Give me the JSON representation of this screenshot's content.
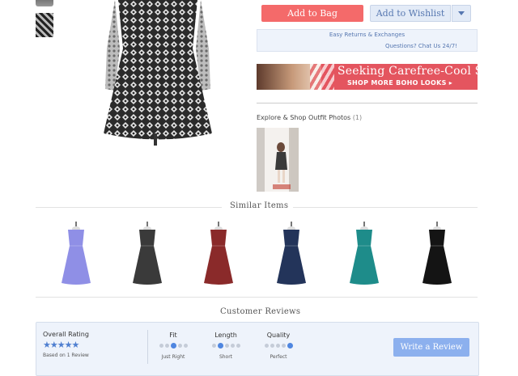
{
  "product": {
    "add_to_bag": "Add to Bag",
    "add_to_wishlist": "Add to Wishlist"
  },
  "info": {
    "returns": "Easy Returns & Exchanges",
    "chat": "Questions? Chat Us 24/7!"
  },
  "banner": {
    "title": "Seeking Carefree-Cool Style?",
    "cta": "SHOP MORE BOHO LOOKS ▸"
  },
  "outfit": {
    "label": "Explore & Shop Outfit Photos",
    "count": "(1)"
  },
  "similar": {
    "title": "Similar Items",
    "items": [
      {
        "icon": "dress-icon",
        "color": "#8f8fe6"
      },
      {
        "icon": "dress-icon",
        "color": "#3a3a3a"
      },
      {
        "icon": "dress-icon",
        "color": "#8a2a2a"
      },
      {
        "icon": "dress-icon",
        "color": "#23345a"
      },
      {
        "icon": "dress-icon",
        "color": "#1e8c8a"
      },
      {
        "icon": "dress-icon",
        "color": "#141414"
      }
    ]
  },
  "reviews": {
    "title": "Customer Reviews",
    "overall_label": "Overall Rating",
    "stars": "★★★★★",
    "based_on": "Based on 1 Review",
    "metrics": [
      {
        "label": "Fit",
        "value": "Just Right",
        "selected": 3,
        "of": 5
      },
      {
        "label": "Length",
        "value": "Short",
        "selected": 2,
        "of": 5
      },
      {
        "label": "Quality",
        "value": "Perfect",
        "selected": 5,
        "of": 5
      }
    ],
    "write_button": "Write a Review"
  },
  "colors": {
    "primary_red": "#f46a6a",
    "accent_blue": "#4f86e0",
    "button_blue": "#8cb0ee"
  }
}
